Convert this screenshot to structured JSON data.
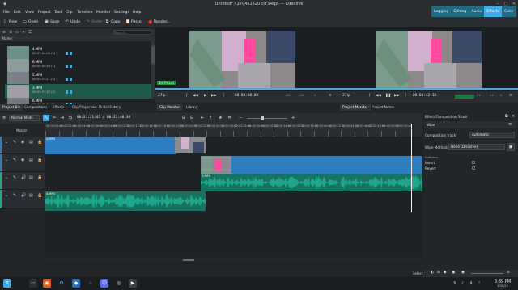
{
  "window": {
    "title": "Untitled* / 2704x1520 59.94fps — Kdenlive"
  },
  "menu": [
    "File",
    "Edit",
    "View",
    "Project",
    "Tool",
    "Clip",
    "Timeline",
    "Monitor",
    "Settings",
    "Help"
  ],
  "workspaces": [
    "Logging",
    "Editing",
    "Audio",
    "Effects",
    "Color"
  ],
  "workspace_active": "Editing",
  "toolbar": {
    "new": "New",
    "open": "Open",
    "save": "Save",
    "undo": "Undo",
    "redo": "Redo",
    "copy": "Copy",
    "paste": "Paste",
    "render": "Render..."
  },
  "bin": {
    "search_placeholder": "Search...",
    "header": "Name",
    "items": [
      {
        "name": "4.MP4",
        "duration": "00:07:44:08 (2)"
      },
      {
        "name": "6.MP4",
        "duration": "00:00:44:20 (1)"
      },
      {
        "name": "5.MP4",
        "duration": "00:03:73:21 (2)"
      },
      {
        "name": "3.MP4",
        "duration": "00:05:73:27 (2)"
      },
      {
        "name": "6.MP4",
        "duration": "00:00:42:41 (1)"
      }
    ],
    "selected_index": 3
  },
  "clip_monitor": {
    "overlay_label": "In Point",
    "zoom": "27ip",
    "timecode": "00:00:00:00",
    "scale_labels": [
      "-20",
      "-10",
      "0"
    ]
  },
  "project_monitor": {
    "zoom": "27ip",
    "timecode": "00:00:42:10",
    "scale_labels": [
      "-20",
      "-10",
      "0"
    ]
  },
  "left_tabs": [
    "Project Bin",
    "Compositions",
    "Effects",
    "Clip Properties",
    "Undo History"
  ],
  "left_tab_active": "Project Bin",
  "center_tabs": [
    "Clip Monitor",
    "Library"
  ],
  "center_tab_active": "Clip Monitor",
  "right_tabs": [
    "Project Monitor",
    "Project Notes"
  ],
  "right_tab_active": "Project Monitor",
  "timeline": {
    "edit_mode": "Normal Mode",
    "position": "00:23:21:45 / 00:23:40:38",
    "master_label": "Master",
    "ruler_ticks": [
      "00:00:00:00",
      "00:00:02:00",
      "00:00:04:00",
      "00:00:06:00",
      "00:00:08:00",
      "00:00:10:00",
      "00:00:12:00",
      "00:00:14:00",
      "00:00:16:00",
      "00:00:18:00",
      "00:00:20:00",
      "00:00:22:00",
      "00:00:24:00",
      "00:00:26:00",
      "00:00:28:00",
      "00:00:30:00",
      "00:00:32:00",
      "00:00:34:00",
      "00:00:36:00",
      "00:00:38:00",
      "00:00:40:00",
      "00:00:42:00",
      "00:00:44:00",
      "00:00:46:00",
      "00:00:48:00",
      "00:00:50:00",
      "00:00:52:00"
    ],
    "tracks": [
      "V2",
      "V1",
      "A1",
      "A2"
    ],
    "clips": {
      "v2_label": "4.MP4",
      "v1_label": "5.MP4",
      "a1_label": "5.MP4",
      "a2_label": "4.MP4"
    },
    "colors": {
      "video": "#2d7fc1",
      "audio": "#1fa58a",
      "audio_dark": "#16735f",
      "selected": "#1f5b4a"
    }
  },
  "effect_stack": {
    "title": "Effect/Composition Stack",
    "effect_name": "Wipe",
    "composition_track_label": "Composition track:",
    "composition_track_value": "Automatic",
    "wipe_method_label": "Wipe Method:",
    "wipe_method_value": "None (Dissolve)",
    "softness_label": "Softness",
    "invert_label": "Invert",
    "revert_label": "Revert"
  },
  "status": {
    "select_label": "Select"
  },
  "clock": {
    "time": "6:39 PM",
    "date": "1/30/22"
  }
}
